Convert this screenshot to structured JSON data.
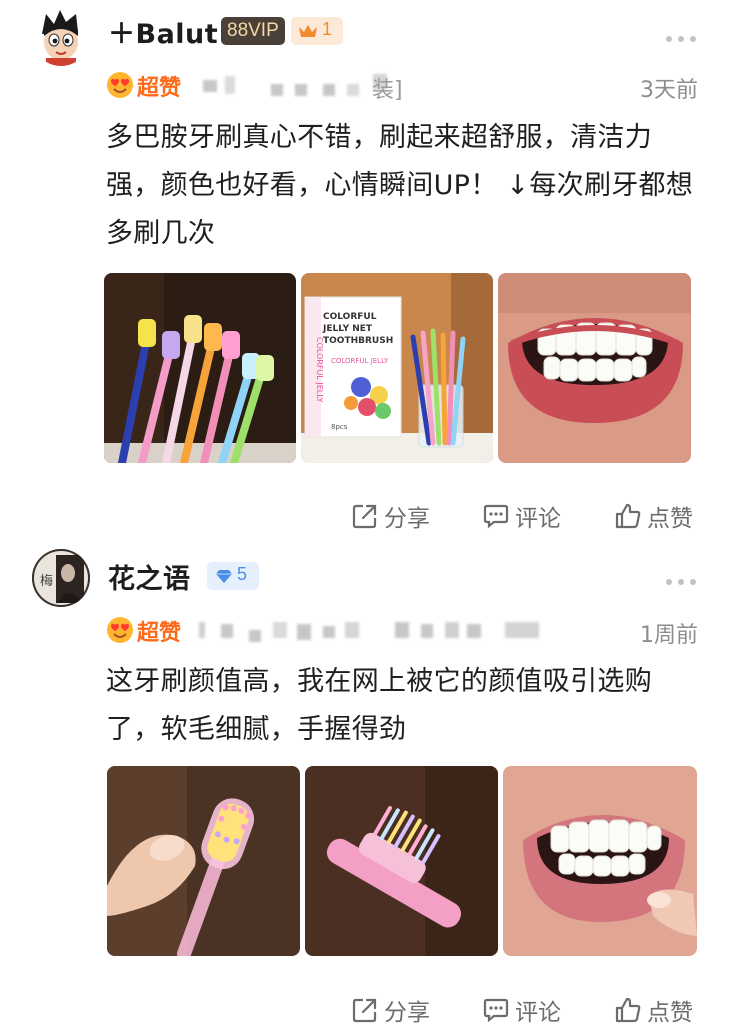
{
  "reviews": [
    {
      "username": "＋Balut",
      "vip_label": "88VIP",
      "crown_count": "1",
      "rating_label": "超赞",
      "spec_tail": "装]",
      "date": "3天前",
      "text": "多巴胺牙刷真心不错，刷起来超舒服，清洁力强，颜色也好看，心情瞬间UP！ ↓每次刷牙都想多刷几次",
      "package_text": {
        "line1": "COLORFUL",
        "line2": "JELLY NET",
        "line3": "TOOTHBRUSH",
        "side": "COLORFUL JELLY",
        "tag": "COLORFUL JELLY",
        "count": "8pcs"
      },
      "actions": {
        "share": "分享",
        "comment": "评论",
        "like": "点赞"
      }
    },
    {
      "username": "花之语",
      "avatar_char": "梅",
      "gem_count": "5",
      "rating_label": "超赞",
      "date": "1周前",
      "text": "这牙刷颜值高，我在网上被它的颜值吸引选购了，软毛细腻，手握得劲",
      "actions": {
        "share": "分享",
        "comment": "评论",
        "like": "点赞"
      }
    }
  ],
  "colors": {
    "accent_orange": "#ff6a1a",
    "vip_bg": "#4a4038",
    "vip_text": "#f0d9a6",
    "gem_blue": "#4a8ee8",
    "muted_text": "#8d8d8d"
  },
  "icons": [
    "more-icon",
    "love-emoji-icon",
    "share-icon",
    "comment-icon",
    "thumbs-up-icon",
    "crown-icon",
    "diamond-icon"
  ]
}
